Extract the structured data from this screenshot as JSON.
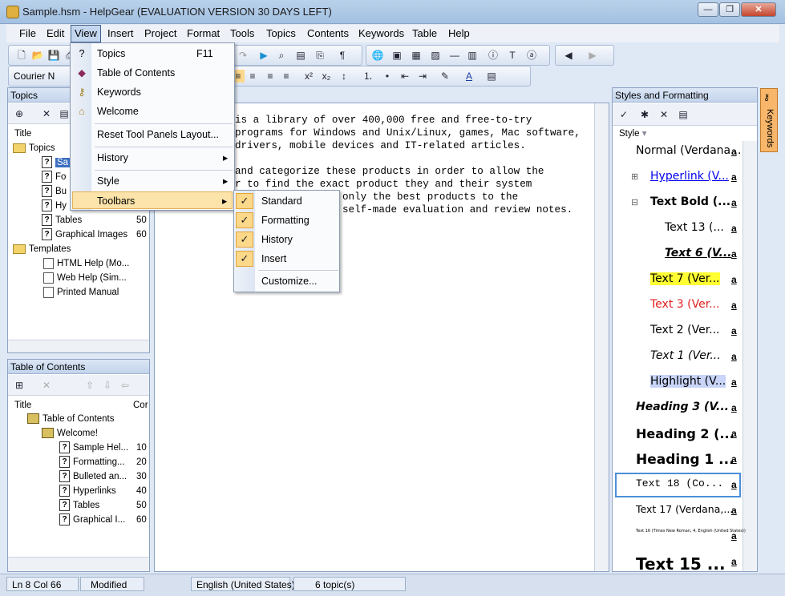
{
  "window": {
    "title": "Sample.hsm - HelpGear (EVALUATION VERSION 30 DAYS LEFT)",
    "min": "—",
    "max": "❐",
    "close": "✕"
  },
  "menubar": [
    "File",
    "Edit",
    "View",
    "Insert",
    "Project",
    "Format",
    "Tools",
    "Topics",
    "Contents",
    "Keywords",
    "Table",
    "Help"
  ],
  "font_box": "Courier N",
  "topics_panel": {
    "title": "Topics",
    "col_title": "Title",
    "items": [
      {
        "label": "Sa",
        "count": ""
      },
      {
        "label": "Fo",
        "count": ""
      },
      {
        "label": "Bu",
        "count": ""
      },
      {
        "label": "Hy",
        "count": ""
      },
      {
        "label": "Tables",
        "count": "50"
      },
      {
        "label": "Graphical Images",
        "count": "60"
      }
    ],
    "templates": "Templates",
    "template_items": [
      "HTML Help (Mo...",
      "Web Help (Sim...",
      "Printed Manual"
    ],
    "expander_root": "Topics"
  },
  "toc_panel": {
    "title": "Table of Contents",
    "col_title": "Title",
    "col_count": "Cor",
    "root": "Table of Contents",
    "welcome": "Welcome!",
    "items": [
      {
        "label": "Sample Hel...",
        "count": "10"
      },
      {
        "label": "Formatting...",
        "count": "20"
      },
      {
        "label": "Bulleted an...",
        "count": "30"
      },
      {
        "label": "Hyperlinks",
        "count": "40"
      },
      {
        "label": "Tables",
        "count": "50"
      },
      {
        "label": "Graphical I...",
        "count": "60"
      }
    ]
  },
  "editor": {
    "lines": [
      "is a library of over 400,000 free and free-to-try",
      "programs for Windows and Unix/Linux, games, Mac software,",
      "drivers, mobile devices and IT-related articles.",
      "",
      "and categorize these products in order to allow the",
      "r to find the exact product they and their system",
      "only the best products to the",
      "self-made evaluation and review notes."
    ]
  },
  "view_menu": {
    "items": [
      {
        "label": "Topics",
        "shortcut": "F11"
      },
      {
        "label": "Table of Contents",
        "shortcut": ""
      },
      {
        "label": "Keywords",
        "shortcut": ""
      },
      {
        "label": "Welcome",
        "shortcut": ""
      },
      {
        "label": "Reset Tool Panels Layout...",
        "shortcut": ""
      },
      {
        "label": "History",
        "shortcut": "▸"
      },
      {
        "label": "Style",
        "shortcut": "▸"
      },
      {
        "label": "Toolbars",
        "shortcut": "▸"
      }
    ]
  },
  "toolbars_menu": {
    "items": [
      "Standard",
      "Formatting",
      "History",
      "Insert"
    ],
    "customize": "Customize...",
    "check": "✓"
  },
  "styles_panel": {
    "title": "Styles and Formatting",
    "col": "Style",
    "keywords_tab": "Keywords",
    "a": "a",
    "items": [
      {
        "label": "Normal (Verdana...",
        "color": "#000000"
      },
      {
        "label": "Hyperlink (V...",
        "color": "#0000ee"
      },
      {
        "label": "Text Bold (...",
        "color": "#000000"
      },
      {
        "label": "Text 13 (...",
        "color": "#000000"
      },
      {
        "label": "Text 6 (V...",
        "color": "#000000"
      },
      {
        "label": "Text 7 (Ver...",
        "color": "#000000"
      },
      {
        "label": "Text 3 (Ver...",
        "color": "#e02020"
      },
      {
        "label": "Text 2 (Ver...",
        "color": "#000000"
      },
      {
        "label": "Text 1 (Ver...",
        "color": "#000000"
      },
      {
        "label": "Highlight (V...",
        "color": "#000000"
      },
      {
        "label": "Heading 3 (V...",
        "color": "#000000"
      },
      {
        "label": "Heading 2 (...",
        "color": "#000000"
      },
      {
        "label": "Heading 1 ...",
        "color": "#000000"
      },
      {
        "label": "Text 18 (Co...",
        "color": "#000000"
      },
      {
        "label": "Text 17 (Verdana,...",
        "color": "#000000"
      },
      {
        "label": "Text 16 (Times New Roman, 4, English (United States))",
        "color": "#000000"
      },
      {
        "label": "Text 15 ...",
        "color": "#000000"
      }
    ]
  },
  "status": {
    "pos": "Ln 8 Col 66",
    "modified": "Modified",
    "lang": "English (United States)",
    "topics": "6 topic(s)"
  }
}
